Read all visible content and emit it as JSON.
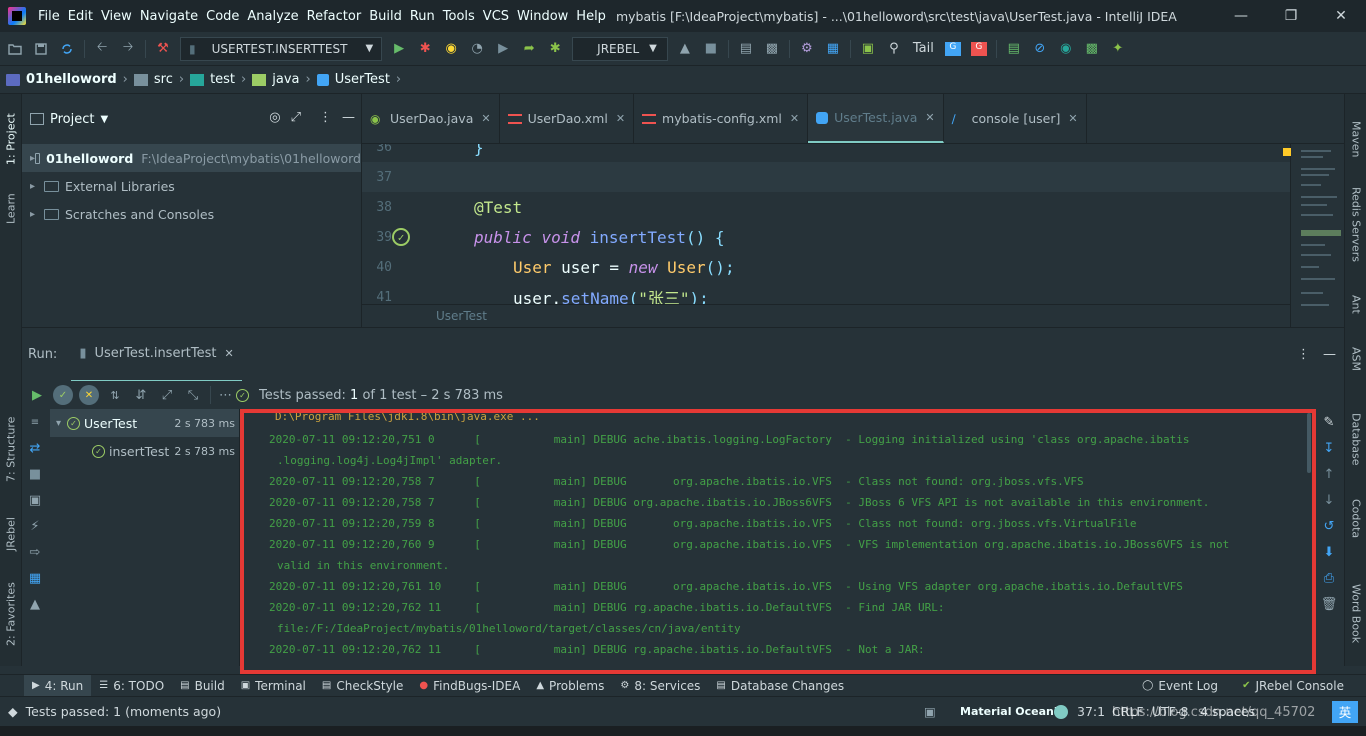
{
  "titlebar": {
    "menu": [
      "File",
      "Edit",
      "View",
      "Navigate",
      "Code",
      "Analyze",
      "Refactor",
      "Build",
      "Run",
      "Tools",
      "VCS",
      "Window",
      "Help"
    ],
    "window_title": "mybatis [F:\\IdeaProject\\mybatis] - ...\\01helloword\\src\\test\\java\\UserTest.java - IntelliJ IDEA",
    "minimize": "—",
    "restore": "❐",
    "close": "✕"
  },
  "toolbar": {
    "run_config": "USERTEST.INSERTTEST",
    "jrebel": "JREBEL",
    "tail": "Tail"
  },
  "breadcrumb": [
    "01helloword",
    "src",
    "test",
    "java",
    "UserTest"
  ],
  "left_strip": {
    "project": "1: Project",
    "learn": "Learn",
    "structure": "7: Structure",
    "jrebel": "JRebel",
    "favorites": "2: Favorites"
  },
  "right_strip": {
    "maven": "Maven",
    "redis": "Redis Servers",
    "ant": "Ant",
    "asm": "ASM",
    "database": "Database",
    "codota": "Codota",
    "wordbook": "Word Book"
  },
  "project_panel": {
    "title": "Project",
    "items": [
      {
        "label": "01helloword",
        "path": "F:\\IdeaProject\\mybatis\\01helloword"
      },
      {
        "label": "External Libraries",
        "path": ""
      },
      {
        "label": "Scratches and Consoles",
        "path": ""
      }
    ]
  },
  "editor": {
    "tabs": [
      {
        "label": "UserDao.java"
      },
      {
        "label": "UserDao.xml"
      },
      {
        "label": "mybatis-config.xml"
      },
      {
        "label": "UserTest.java"
      },
      {
        "label": "console [user]"
      }
    ],
    "line_numbers": [
      "36",
      "37",
      "38",
      "39",
      "40",
      "41"
    ],
    "line36": "}",
    "line38_ann": "@Test",
    "line39_kw1": "public",
    "line39_kw2": "void",
    "line39_fn": "insertTest",
    "line39_rest": "() {",
    "line40_ty": "User",
    "line40_var": " user = ",
    "line40_kw": "new",
    "line40_ty2": "User",
    "line40_rest": "();",
    "line41_obj": "user.",
    "line41_fn": "setName",
    "line41_p1": "(",
    "line41_str": "\"张三\"",
    "line41_p2": ");",
    "crumb": "UserTest"
  },
  "run": {
    "label": "Run:",
    "tab": "UserTest.insertTest",
    "passed_prefix": "Tests passed:",
    "passed_count": "1",
    "passed_rest": "of 1 test – 2 s 783 ms",
    "tests": [
      {
        "label": "UserTest",
        "duration": "2 s 783 ms"
      },
      {
        "label": "insertTest",
        "duration": "2 s 783 ms"
      }
    ]
  },
  "console": {
    "cmd": "D:\\Program Files\\jdk1.8\\bin\\java.exe ...",
    "lines": [
      "2020-07-11 09:12:20,751 0      [           main] DEBUG ache.ibatis.logging.LogFactory  - Logging initialized using 'class org.apache.ibatis",
      ".logging.log4j.Log4jImpl' adapter.",
      "2020-07-11 09:12:20,758 7      [           main] DEBUG       org.apache.ibatis.io.VFS  - Class not found: org.jboss.vfs.VFS",
      "2020-07-11 09:12:20,758 7      [           main] DEBUG org.apache.ibatis.io.JBoss6VFS  - JBoss 6 VFS API is not available in this environment.",
      "2020-07-11 09:12:20,759 8      [           main] DEBUG       org.apache.ibatis.io.VFS  - Class not found: org.jboss.vfs.VirtualFile",
      "2020-07-11 09:12:20,760 9      [           main] DEBUG       org.apache.ibatis.io.VFS  - VFS implementation org.apache.ibatis.io.JBoss6VFS is not",
      "valid in this environment.",
      "2020-07-11 09:12:20,761 10     [           main] DEBUG       org.apache.ibatis.io.VFS  - Using VFS adapter org.apache.ibatis.io.DefaultVFS",
      "2020-07-11 09:12:20,762 11     [           main] DEBUG rg.apache.ibatis.io.DefaultVFS  - Find JAR URL:",
      "file:/F:/IdeaProject/mybatis/01helloword/target/classes/cn/java/entity",
      "2020-07-11 09:12:20,762 11     [           main] DEBUG rg.apache.ibatis.io.DefaultVFS  - Not a JAR:"
    ]
  },
  "tool_windows": [
    {
      "label": "4: Run",
      "icon": "▶"
    },
    {
      "label": "6: TODO",
      "icon": "☰"
    },
    {
      "label": "Build",
      "icon": "▤"
    },
    {
      "label": "Terminal",
      "icon": "▣"
    },
    {
      "label": "CheckStyle",
      "icon": "▤"
    },
    {
      "label": "FindBugs-IDEA",
      "icon": "●"
    },
    {
      "label": "Problems",
      "icon": "▲"
    },
    {
      "label": "8: Services",
      "icon": "⚙"
    },
    {
      "label": "Database Changes",
      "icon": "▤"
    }
  ],
  "tool_windows_right": [
    {
      "label": "Event Log",
      "icon": "◯"
    },
    {
      "label": "JRebel Console",
      "icon": "✔"
    }
  ],
  "status": {
    "message": "Tests passed: 1 (moments ago)",
    "theme": "Material Oceanic",
    "position": "37:1",
    "line_sep": "CRLF",
    "encoding": "UTF-8",
    "indent": "4 spaces",
    "watermark": "https://blog.csdn.net/qq_45702",
    "ime": "英"
  },
  "colors": {
    "accent": "#80cbc4",
    "log_text": "#43a047",
    "highlight_frame": "#e53935"
  }
}
